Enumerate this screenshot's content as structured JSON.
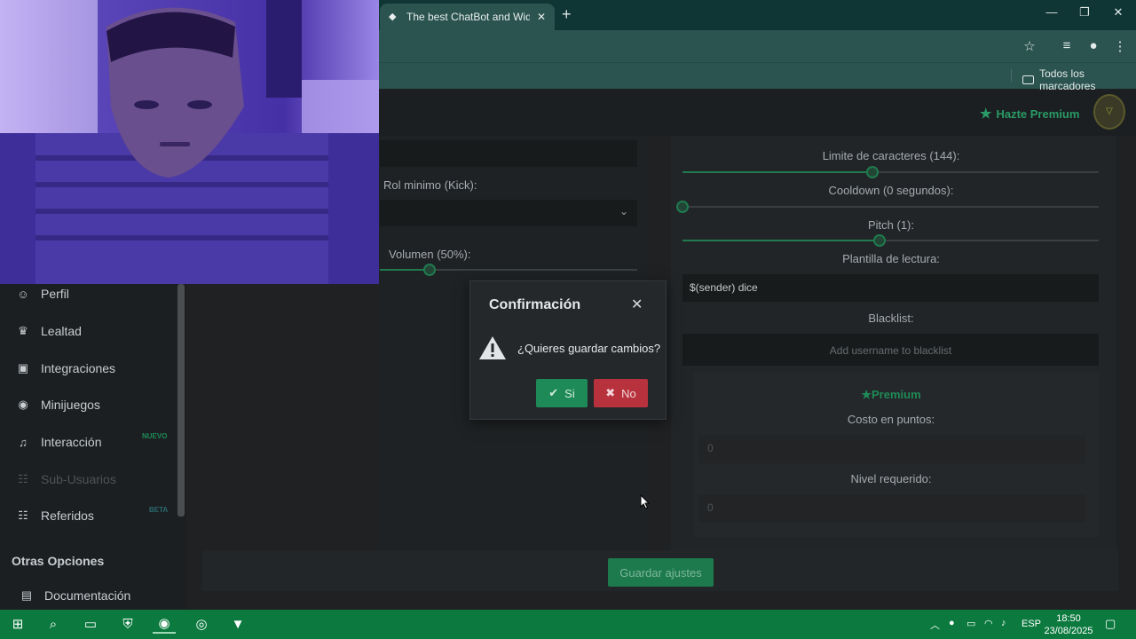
{
  "browser": {
    "tab_title": "The best ChatBot and Widgets",
    "new_tab": "+",
    "bookmarks_label": "Todos los marcadores"
  },
  "header": {
    "premium_label": "Hazte Premium"
  },
  "left_panel": {
    "role_label": "Rol minimo (Kick):",
    "volume_label": "Volumen (50%):",
    "volume_value": 0.5
  },
  "right_panel": {
    "char_limit_label": "Limite de caracteres (144):",
    "char_limit_value": 144,
    "cooldown_label": "Cooldown (0 segundos):",
    "cooldown_value": 0,
    "pitch_label": "Pitch (1):",
    "pitch_value": 1,
    "template_label": "Plantilla de lectura:",
    "template_value": "$(sender) dice",
    "blacklist_label": "Blacklist:",
    "blacklist_placeholder": "Add username to blacklist",
    "premium_heading": "Premium",
    "cost_label": "Costo en puntos:",
    "cost_value": "0",
    "level_label": "Nivel requerido:",
    "level_value": "0"
  },
  "save_button": "Guardar ajustes",
  "sidebar": {
    "items": [
      {
        "label": "Perfil",
        "icon": "user-icon"
      },
      {
        "label": "Lealtad",
        "icon": "trophy-icon"
      },
      {
        "label": "Integraciones",
        "icon": "window-icon"
      },
      {
        "label": "Minijuegos",
        "icon": "gamepad-icon"
      },
      {
        "label": "Interacción",
        "icon": "music-icon",
        "badge": "NUEVO"
      },
      {
        "label": "Sub-Usuarios",
        "icon": "users-icon"
      },
      {
        "label": "Referidos",
        "icon": "users-icon",
        "badge": "BETA"
      }
    ],
    "other_heading": "Otras Opciones",
    "docs_label": "Documentación"
  },
  "modal": {
    "title": "Confirmación",
    "message": "¿Quieres guardar cambios?",
    "yes": "Si",
    "no": "No"
  },
  "taskbar": {
    "language": "ESP",
    "time": "18:50",
    "date": "23/08/2025"
  },
  "colors": {
    "accent_green": "#1e8a57",
    "danger_red": "#b8323d",
    "taskbar": "#0c7a3f",
    "chrome": "#2b5350"
  }
}
